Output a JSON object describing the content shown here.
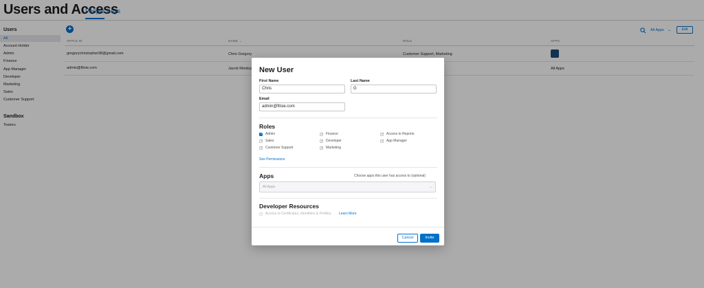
{
  "header": {
    "title": "Users and Access",
    "tabs": [
      {
        "label": "People",
        "active": true
      },
      {
        "label": "Keys",
        "active": false
      }
    ]
  },
  "sidebar": {
    "users_heading": "Users",
    "users_items": [
      "All",
      "Account Holder",
      "Admin",
      "Finance",
      "App Manager",
      "Developer",
      "Marketing",
      "Sales",
      "Customer Support"
    ],
    "sandbox_heading": "Sandbox",
    "sandbox_items": [
      "Testers"
    ]
  },
  "toolbar": {
    "add_icon": "plus-circle-icon",
    "search_icon": "search-icon",
    "filter_label": "All Apps",
    "edit_label": "Edit"
  },
  "table": {
    "headers": [
      "APPLE ID",
      "NAME ⌄",
      "ROLE",
      "APPS"
    ],
    "rows": [
      {
        "apple_id": "gregorychristopher98@gmail.com",
        "name": "Chris Gregory",
        "role": "Customer Support, Marketing",
        "apps": ""
      },
      {
        "apple_id": "admin@fitsie.com",
        "name": "Jacob Montoy",
        "role": "",
        "apps": "All Apps"
      }
    ]
  },
  "modal": {
    "title": "New User",
    "first_name_label": "First Name",
    "first_name_value": "Chris",
    "last_name_label": "Last Name",
    "last_name_value": "G",
    "email_label": "Email",
    "email_value": "admin@fitsie.com",
    "roles_title": "Roles",
    "roles": [
      {
        "label": "Admin",
        "checked": true
      },
      {
        "label": "Finance",
        "checked": false
      },
      {
        "label": "Access to Reports",
        "checked": false
      },
      {
        "label": "Sales",
        "checked": false
      },
      {
        "label": "Developer",
        "checked": false
      },
      {
        "label": "App Manager",
        "checked": false
      },
      {
        "label": "Customer Support",
        "checked": false
      },
      {
        "label": "Marketing",
        "checked": false
      }
    ],
    "see_permissions": "See Permissions",
    "apps_title": "Apps",
    "apps_hint": "Choose apps this user has access to (optional)",
    "apps_select_value": "All Apps",
    "dev_title": "Developer Resources",
    "dev_checkbox_label": "Access to Certificates, Identifiers & Profiles.",
    "learn_more": "Learn More",
    "cancel_label": "Cancel",
    "invite_label": "Invite"
  },
  "colors": {
    "accent": "#0070c9",
    "overlay": "rgba(0,0,0,0.33)"
  }
}
